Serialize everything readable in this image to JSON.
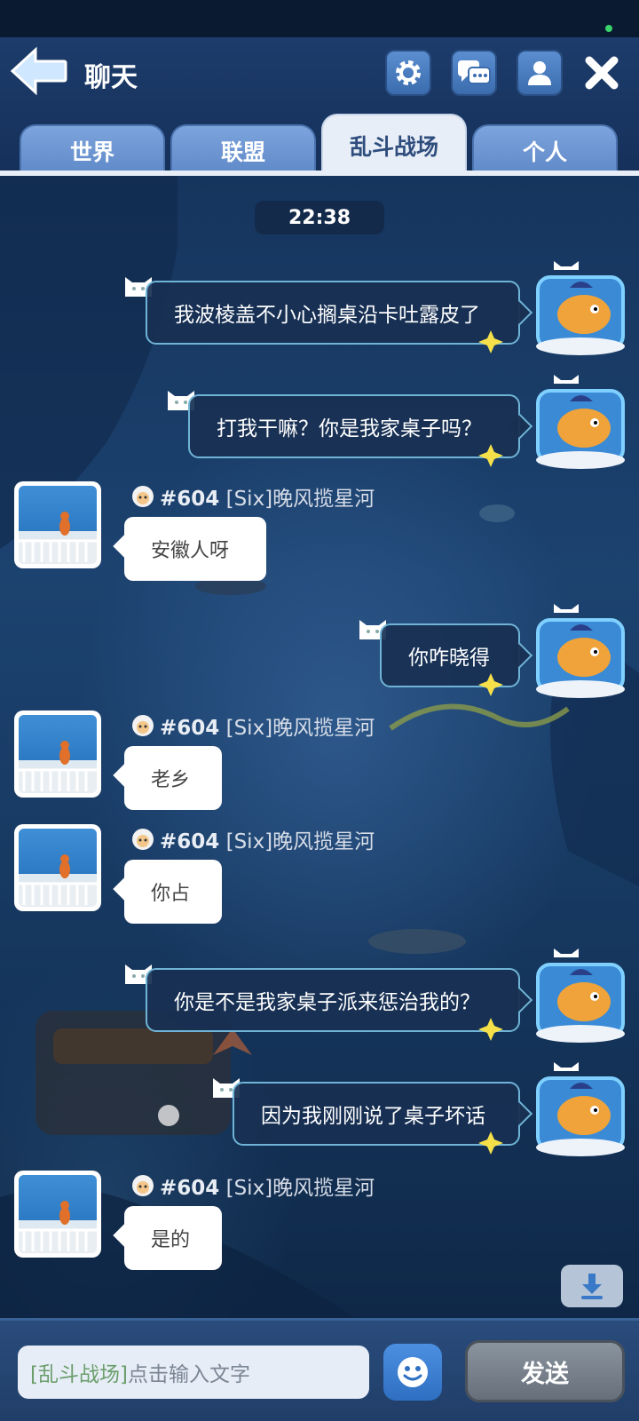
{
  "header": {
    "title": "聊天",
    "icons": [
      "back-arrow-icon",
      "gear-icon",
      "chat-bubbles-icon",
      "person-icon",
      "close-icon"
    ]
  },
  "tabs": [
    {
      "label": "世界",
      "active": false
    },
    {
      "label": "联盟",
      "active": false
    },
    {
      "label": "乱斗战场",
      "active": true
    },
    {
      "label": "个人",
      "active": false
    }
  ],
  "chat": {
    "time": "22:38",
    "messages": [
      {
        "side": "out",
        "text": "我波棱盖不小心搁桌沿卡吐露皮了"
      },
      {
        "side": "out",
        "text": "打我干嘛？你是我家桌子吗？"
      },
      {
        "side": "in",
        "sender_id": "#604",
        "sender_name": "[Six]晚风揽星河",
        "text": "安徽人呀"
      },
      {
        "side": "out",
        "text": "你咋晓得"
      },
      {
        "side": "in",
        "sender_id": "#604",
        "sender_name": "[Six]晚风揽星河",
        "text": "老乡"
      },
      {
        "side": "in",
        "sender_id": "#604",
        "sender_name": "[Six]晚风揽星河",
        "text": "你占"
      },
      {
        "side": "out",
        "text": "你是不是我家桌子派来惩治我的？"
      },
      {
        "side": "out",
        "text": "因为我刚刚说了桌子坏话"
      },
      {
        "side": "in",
        "sender_id": "#604",
        "sender_name": "[Six]晚风揽星河",
        "text": "是的"
      }
    ]
  },
  "footer": {
    "input_prefix": "[乱斗战场]",
    "input_placeholder": "点击输入文字",
    "send_label": "发送"
  },
  "colors": {
    "header_bg": "#1d3c6b",
    "tab_inactive": "#6e98d4",
    "tab_active": "#e8eef7",
    "out_bubble_border": "#6fb4d6",
    "send_button": "#7a848f"
  }
}
